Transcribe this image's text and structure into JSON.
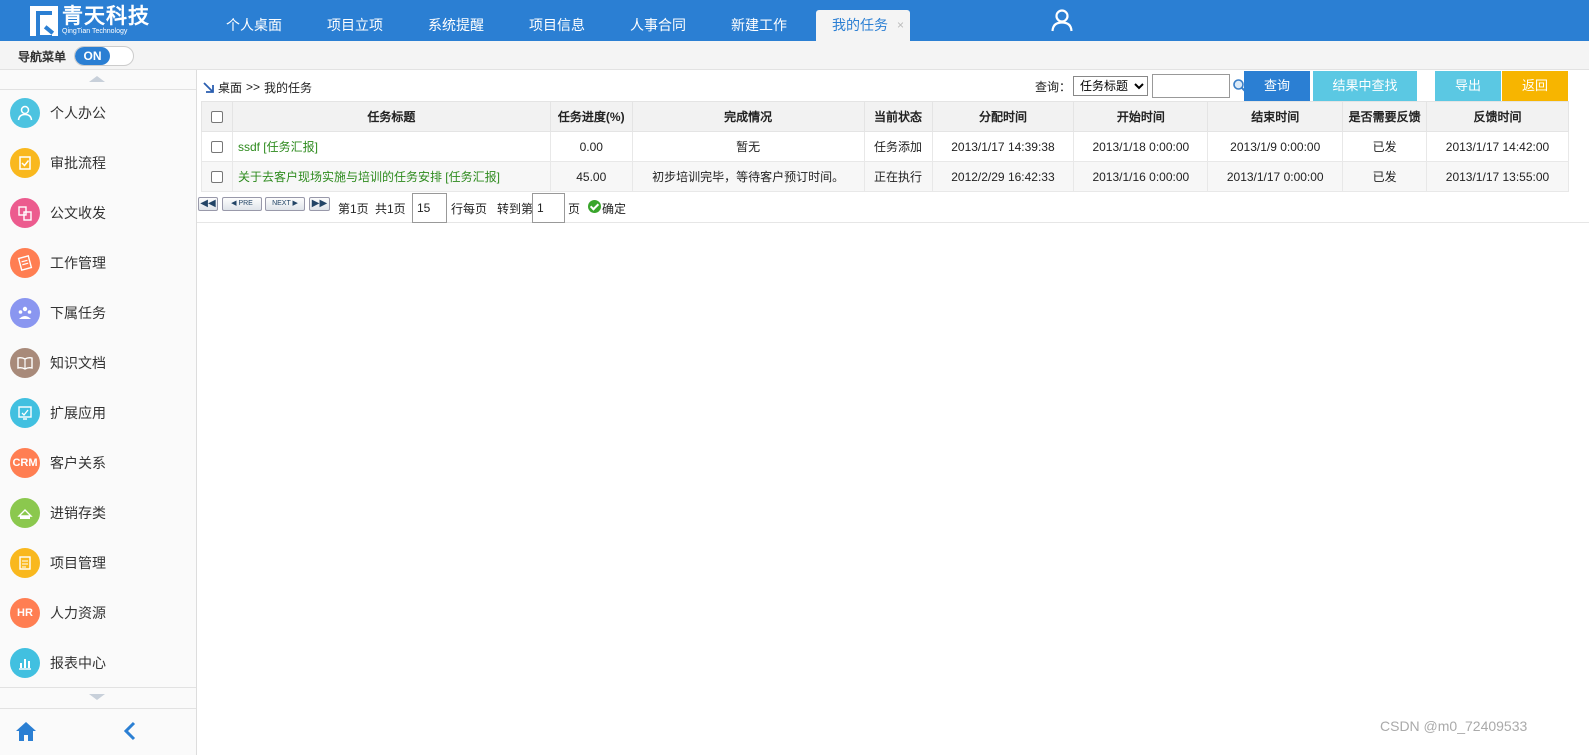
{
  "app": {
    "logo_cn": "青天科技",
    "logo_en": "QingTian Technology"
  },
  "nav": {
    "tabs": [
      {
        "label": "个人桌面"
      },
      {
        "label": "项目立项"
      },
      {
        "label": "系统提醒"
      },
      {
        "label": "项目信息"
      },
      {
        "label": "人事合同"
      },
      {
        "label": "新建工作"
      },
      {
        "label": "我的任务",
        "active": true
      }
    ],
    "close_glyph": "×"
  },
  "toggle": {
    "label": "导航菜单",
    "state": "ON"
  },
  "sidebar": {
    "items": [
      {
        "label": "个人办公",
        "icon": "person-icon",
        "color": "#4cc3e0"
      },
      {
        "label": "审批流程",
        "icon": "approval-icon",
        "color": "#f9b81e"
      },
      {
        "label": "公文收发",
        "icon": "document-exchange-icon",
        "color": "#ec5b8e"
      },
      {
        "label": "工作管理",
        "icon": "work-icon",
        "color": "#ff7e52"
      },
      {
        "label": "下属任务",
        "icon": "team-icon",
        "color": "#8a96f0"
      },
      {
        "label": "知识文档",
        "icon": "book-icon",
        "color": "#a88a7a"
      },
      {
        "label": "扩展应用",
        "icon": "extension-icon",
        "color": "#41c0e0"
      },
      {
        "label": "客户关系",
        "icon": "crm-icon",
        "color": "#ff7e52",
        "badge": "CRM"
      },
      {
        "label": "进销存类",
        "icon": "inventory-icon",
        "color": "#8bc84e"
      },
      {
        "label": "项目管理",
        "icon": "project-icon",
        "color": "#f9b81e"
      },
      {
        "label": "人力资源",
        "icon": "hr-icon",
        "color": "#ff7e52",
        "badge": "HR"
      },
      {
        "label": "报表中心",
        "icon": "report-icon",
        "color": "#41c0e0"
      }
    ]
  },
  "breadcrumb": {
    "root": "桌面",
    "separator": ">>",
    "current": "我的任务"
  },
  "search": {
    "label": "查询：",
    "select_value": "任务标题",
    "input_value": "",
    "query_button": "查询",
    "in_result_button": "结果中查找",
    "export_button": "导出",
    "back_button": "返回"
  },
  "table": {
    "columns": [
      "任务标题",
      "任务进度(%)",
      "完成情况",
      "当前状态",
      "分配时间",
      "开始时间",
      "结束时间",
      "是否需要反馈",
      "反馈时间"
    ],
    "rows": [
      {
        "title": "ssdf [任务汇报]",
        "progress": "0.00",
        "completion": "暂无",
        "status": "任务添加",
        "assigned": "2013/1/17 14:39:38",
        "start": "2013/1/18 0:00:00",
        "end": "2013/1/9 0:00:00",
        "feedback": "已发",
        "feedback_time": "2013/1/17 14:42:00"
      },
      {
        "title": "关于去客户现场实施与培训的任务安排 [任务汇报]",
        "progress": "45.00",
        "completion": "初步培训完毕，等待客户预订时间。",
        "status": "正在执行",
        "assigned": "2012/2/29 16:42:33",
        "start": "2013/1/16 0:00:00",
        "end": "2013/1/17 0:00:00",
        "feedback": "已发",
        "feedback_time": "2013/1/17 13:55:00"
      }
    ]
  },
  "pager": {
    "pre": "PRE",
    "next": "NEXT",
    "page_text": "第1页",
    "total_text": "共1页",
    "per_page": "15",
    "per_page_suffix": "行每页",
    "goto_prefix": "转到第",
    "goto_value": "1",
    "goto_suffix": "页",
    "confirm": "确定"
  },
  "watermark": "CSDN @m0_72409533"
}
